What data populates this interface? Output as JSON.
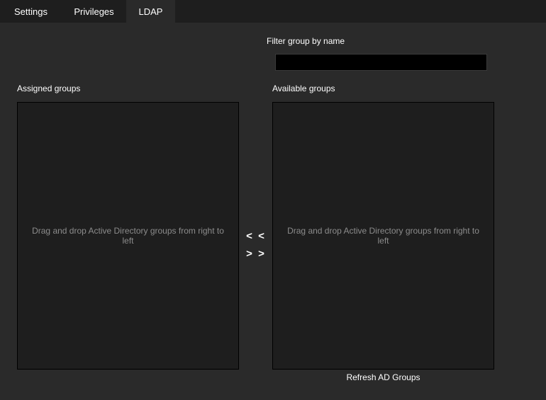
{
  "tabs": [
    {
      "label": "Settings"
    },
    {
      "label": "Privileges"
    },
    {
      "label": "LDAP"
    }
  ],
  "filter": {
    "label": "Filter group by name",
    "value": ""
  },
  "assigned": {
    "label": "Assigned groups",
    "hint": "Drag and drop Active Directory groups from right to left"
  },
  "available": {
    "label": "Available groups",
    "hint": "Drag and drop Active Directory groups from right to left"
  },
  "transfer": {
    "move_left": "< <",
    "move_right": "> >"
  },
  "refresh_label": "Refresh AD Groups"
}
